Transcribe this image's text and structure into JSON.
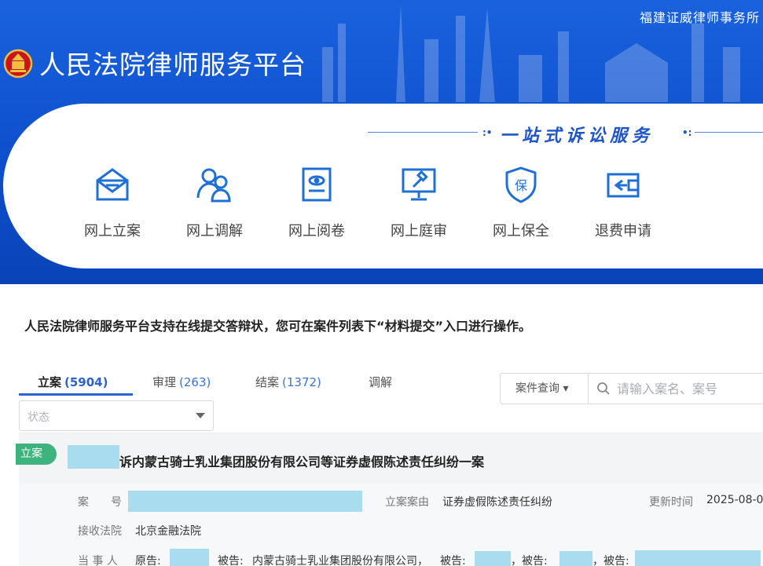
{
  "header": {
    "firm_name": "福建证威律师事务所",
    "platform_title": "人民法院律师服务平台",
    "slogan": "一站式诉讼服务",
    "colors": {
      "primary": "#0e4fcd",
      "accent": "#1e56c9",
      "badge_green": "#3db37d",
      "redact": "#a8dcee"
    }
  },
  "services": [
    {
      "label": "网上立案",
      "icon": "mail-icon"
    },
    {
      "label": "网上调解",
      "icon": "people-icon"
    },
    {
      "label": "网上阅卷",
      "icon": "document-icon"
    },
    {
      "label": "网上庭审",
      "icon": "gavel-screen-icon"
    },
    {
      "label": "网上保全",
      "icon": "shield-bao-icon"
    },
    {
      "label": "退费申请",
      "icon": "refund-icon"
    }
  ],
  "notice": "人民法院律师服务平台支持在线提交答辩状，您可在案件列表下“材料提交”入口进行操作。",
  "tabs": [
    {
      "label": "立案",
      "count": "(5904)"
    },
    {
      "label": "审理",
      "count": "(263)"
    },
    {
      "label": "结案",
      "count": "(1372)"
    },
    {
      "label": "调解",
      "count": ""
    }
  ],
  "search": {
    "type_label": "案件查询 ▾",
    "placeholder": "请输入案名、案号"
  },
  "filter": {
    "status_placeholder": "状态"
  },
  "case": {
    "badge": "立案",
    "title": "诉内蒙古骑士乳业集团股份有限公司等证券虚假陈述责任纠纷一案",
    "case_no_label": "案　　号",
    "cause_label": "立案案由",
    "cause_value": "证券虚假陈述责任纠纷",
    "update_label": "更新时间",
    "update_value": "2025-08-0",
    "court_label": "接收法院",
    "court_value": "北京金融法院",
    "parties_label": "当 事 人",
    "plaintiff_label": "原告:",
    "defendant_label": "被告:",
    "defendant_1": "内蒙古骑士乳业集团股份有限公司，",
    "defendant_tail_1": "被告:",
    "defendant_tail_2": "，被告:",
    "defendant_tail_3": "，被告:"
  }
}
